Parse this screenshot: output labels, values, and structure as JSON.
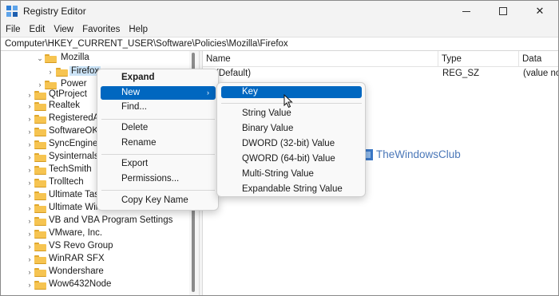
{
  "window": {
    "title": "Registry Editor",
    "icon": "registry-icon"
  },
  "menubar": [
    "File",
    "Edit",
    "View",
    "Favorites",
    "Help"
  ],
  "address": "Computer\\HKEY_CURRENT_USER\\Software\\Policies\\Mozilla\\Firefox",
  "tree": {
    "items": [
      {
        "label": "Mozilla",
        "expanded": true
      },
      {
        "label": "Firefox",
        "selected": true
      },
      {
        "label": "Power"
      },
      {
        "label": "QtProject"
      },
      {
        "label": "Realtek"
      },
      {
        "label": "RegisteredAp"
      },
      {
        "label": "SoftwareOK"
      },
      {
        "label": "SyncEngines"
      },
      {
        "label": "Sysinternals"
      },
      {
        "label": "TechSmith"
      },
      {
        "label": "Trolltech"
      },
      {
        "label": "Ultimate Task"
      },
      {
        "label": "Ultimate Win"
      },
      {
        "label": "VB and VBA Program Settings"
      },
      {
        "label": "VMware, Inc."
      },
      {
        "label": "VS Revo Group"
      },
      {
        "label": "WinRAR SFX"
      },
      {
        "label": "Wondershare"
      },
      {
        "label": "Wow6432Node"
      }
    ]
  },
  "list": {
    "columns": [
      "Name",
      "Type",
      "Data"
    ],
    "rows": [
      {
        "name": "(Default)",
        "type": "REG_SZ",
        "data": "(value no"
      }
    ]
  },
  "context_menu": {
    "items": [
      "Expand",
      "New",
      "Find...",
      "Delete",
      "Rename",
      "Export",
      "Permissions...",
      "Copy Key Name"
    ],
    "highlighted": "New"
  },
  "submenu": {
    "items": [
      "Key",
      "String Value",
      "Binary Value",
      "DWORD (32-bit) Value",
      "QWORD (64-bit) Value",
      "Multi-String Value",
      "Expandable String Value"
    ],
    "highlighted": "Key"
  },
  "watermark": "TheWindowsClub",
  "colors": {
    "highlight": "#0067c0",
    "selection": "#cce4f7",
    "folder": "#f6c451",
    "watermark": "#4a77b8"
  }
}
